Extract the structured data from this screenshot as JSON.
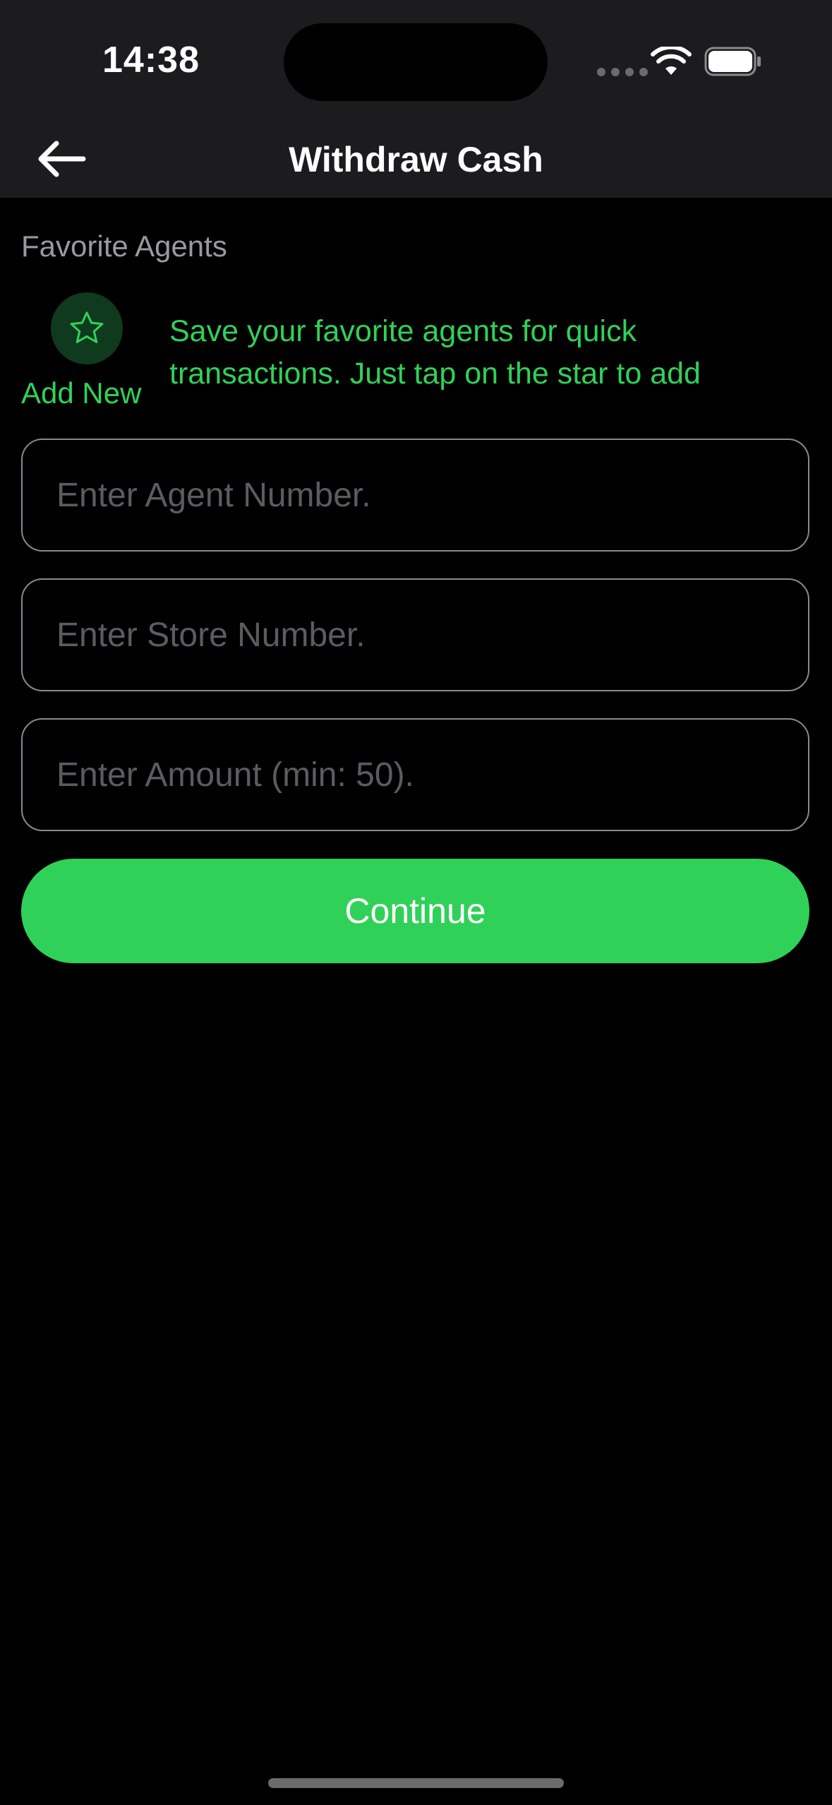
{
  "status_bar": {
    "time": "14:38"
  },
  "header": {
    "title": "Withdraw Cash",
    "back_icon": "arrow-left-icon"
  },
  "favorites": {
    "section_label": "Favorite Agents",
    "add_new_label": "Add New",
    "add_new_icon": "star-icon",
    "hint": "Save your favorite agents for quick transactions. Just tap on the star to add"
  },
  "form": {
    "agent_number": {
      "value": "",
      "placeholder": "Enter Agent Number."
    },
    "store_number": {
      "value": "",
      "placeholder": "Enter Store Number."
    },
    "amount": {
      "value": "",
      "placeholder": "Enter Amount (min: 50)."
    }
  },
  "actions": {
    "continue_label": "Continue"
  },
  "colors": {
    "accent": "#30d158",
    "background": "#000000",
    "bar_background": "#1c1c1e",
    "star_circle": "#0f3a1d"
  }
}
